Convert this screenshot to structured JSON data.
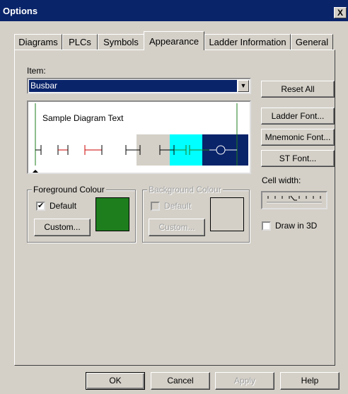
{
  "window": {
    "title": "Options",
    "close_glyph": "X"
  },
  "tabs": [
    {
      "label": "Diagrams"
    },
    {
      "label": "PLCs"
    },
    {
      "label": "Symbols"
    },
    {
      "label": "Appearance",
      "active": true
    },
    {
      "label": "Ladder Information"
    },
    {
      "label": "General"
    }
  ],
  "item": {
    "label": "Item:",
    "selected": "Busbar"
  },
  "preview": {
    "sample_text": "Sample Diagram Text"
  },
  "right_buttons": {
    "reset_all": "Reset All",
    "ladder_font": "Ladder Font...",
    "mnemonic_font": "Mnemonic Font...",
    "st_font": "ST Font..."
  },
  "cell_width": {
    "label": "Cell width:"
  },
  "draw_3d": {
    "label": "Draw in 3D",
    "checked": false
  },
  "foreground": {
    "legend": "Foreground Colour",
    "default_label": "Default",
    "default_checked": true,
    "custom_label": "Custom...",
    "color": "#1e7e1e"
  },
  "background": {
    "legend": "Background Colour",
    "default_label": "Default",
    "default_checked": false,
    "custom_label": "Custom...",
    "color": "#d4d0c8"
  },
  "footer": {
    "ok": "OK",
    "cancel": "Cancel",
    "apply": "Apply",
    "help": "Help"
  },
  "colors": {
    "busbar": "#1e7e1e",
    "red_contact": "#cc0000",
    "cyan": "#00ffff",
    "navy": "#0a246a",
    "gray": "#d4d0c8"
  }
}
